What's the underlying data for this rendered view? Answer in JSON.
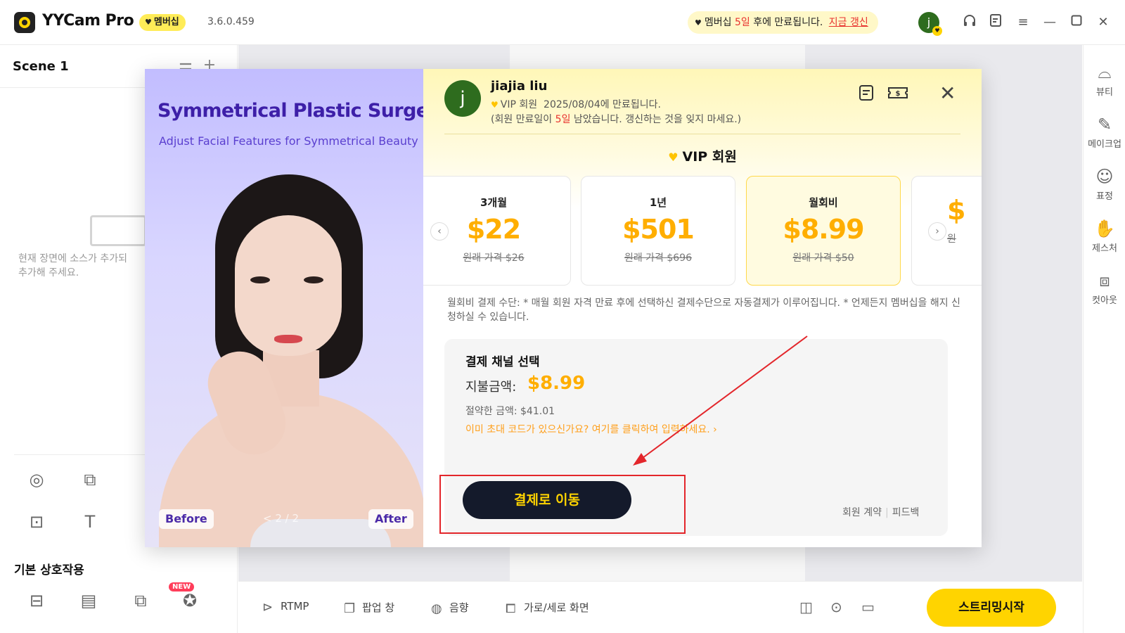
{
  "titlebar": {
    "app_name": "YYCam Pro",
    "membership_tag": "멤버십",
    "version": "3.6.0.459",
    "expiry_prefix": "멤버십",
    "expiry_days": "5일",
    "expiry_suffix": "후에 만료됩니다.",
    "renew_link": "지금 갱신",
    "avatar_letter": "j"
  },
  "left_panel": {
    "scene_title": "Scene 1",
    "empty_text_line1": "현재 장면에 소스가 추가되",
    "empty_text_line2": "추가해 주세요."
  },
  "basic_section": {
    "title": "기본 상호작용",
    "new_badge": "NEW"
  },
  "bottom_toolbar": {
    "rtmp": "RTMP",
    "popup": "팝업 창",
    "audio": "음향",
    "orientation": "가로/세로 화면",
    "stream_button": "스트리밍시작"
  },
  "right_sidebar": {
    "items": [
      {
        "label": "뷰티",
        "icon": "beauty-icon"
      },
      {
        "label": "메이크업",
        "icon": "makeup-icon"
      },
      {
        "label": "표정",
        "icon": "emoji-icon"
      },
      {
        "label": "제스처",
        "icon": "gesture-icon"
      },
      {
        "label": "컷아웃",
        "icon": "cutout-icon"
      }
    ]
  },
  "promo": {
    "title": "Symmetrical Plastic Surgery",
    "subtitle": "Adjust Facial Features for Symmetrical Beauty",
    "before": "Before",
    "after": "After",
    "pager": "< 2 / 2"
  },
  "modal": {
    "user_name": "jiajia liu",
    "avatar_letter": "j",
    "vip_status": "VIP 회원",
    "vip_expiry": "2025/08/04에 만료됩니다.",
    "remind_prefix": "(회원 만료일이",
    "remind_days": "5일",
    "remind_suffix": "남았습니다. 갱신하는 것을 잊지 마세요.)",
    "section_title": "VIP 회원",
    "plans": [
      {
        "name": "3개월",
        "price": "$22",
        "original": "원래 가격 $26",
        "selected": false
      },
      {
        "name": "1년",
        "price": "$501",
        "original": "원래 가격 $696",
        "selected": false
      },
      {
        "name": "월회비",
        "price": "$8.99",
        "original": "원래 가격 $50",
        "selected": true
      },
      {
        "name": "",
        "price": "$",
        "original": "원",
        "selected": false
      }
    ],
    "pay_note": "월회비 결제 수단: * 매월 회원 자격 만료 후에 선택하신 결제수단으로 자동결제가 이루어집니다. * 언제든지 멤버십을 해지 신청하실 수 있습니다.",
    "payment": {
      "title": "결제 채널 선택",
      "amount_label": "지불금액:",
      "amount": "$8.99",
      "saved": "절약한 금액: $41.01",
      "invite_link": "이미 초대 코드가 있으신가요? 여기를 클릭하여 입력하세요. ›",
      "pay_button": "결제로 이동",
      "terms_link": "회원 계약",
      "feedback_link": "피드백"
    }
  },
  "colors": {
    "accent_yellow": "#ffd400",
    "price_orange": "#ffae00",
    "alert_red": "#e8322f",
    "promo_purple": "#3d1fa8",
    "pay_button_bg": "#141a2b"
  }
}
